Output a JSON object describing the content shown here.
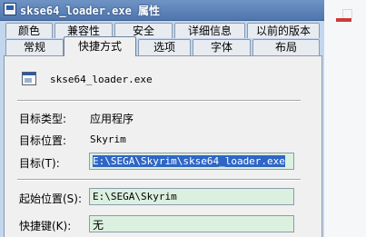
{
  "window": {
    "title": "skse64_loader.exe 属性"
  },
  "tabs_row1": [
    "颜色",
    "兼容性",
    "安全",
    "详细信息",
    "以前的版本"
  ],
  "tabs_row2": [
    "常规",
    "快捷方式",
    "选项",
    "字体",
    "布局"
  ],
  "active_tab": "快捷方式",
  "shortcut": {
    "name": "skse64_loader.exe",
    "target_type_label": "目标类型:",
    "target_type_value": "应用程序",
    "target_location_label": "目标位置:",
    "target_location_value": "Skyrim",
    "target_label": "目标(T):",
    "target_value": "E:\\SEGA\\Skyrim\\skse64_loader.exe",
    "start_in_label": "起始位置(S):",
    "start_in_value": "E:\\SEGA\\Skyrim",
    "hotkey_label": "快捷键(K):",
    "hotkey_value": "无"
  },
  "colors": {
    "titlebar": "#5a7fb8",
    "tab_area": "#c2d6ee",
    "field_background": "#dbf0df",
    "selection": "#2f66c6"
  }
}
